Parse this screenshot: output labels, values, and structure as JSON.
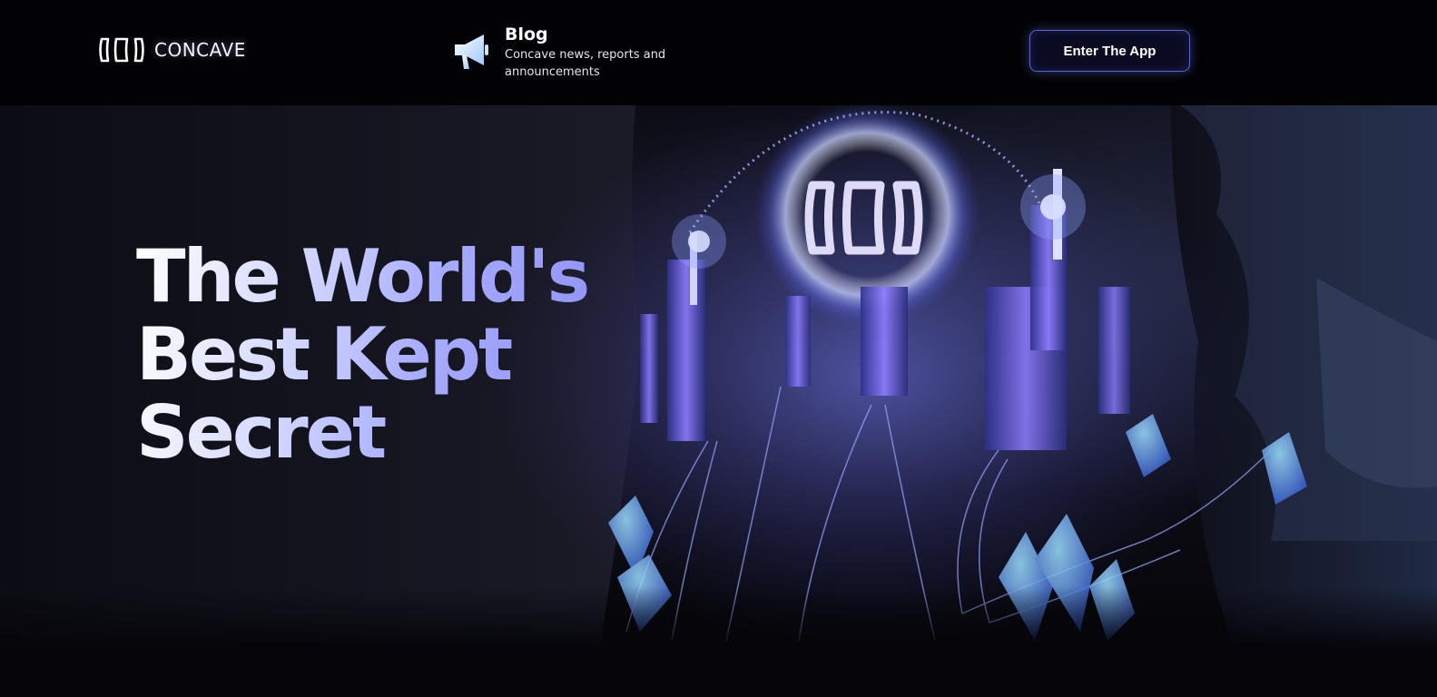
{
  "header": {
    "logo_text": "CONCAVE",
    "blog": {
      "title": "Blog",
      "description": "Concave news, reports and announcements"
    },
    "cta_label": "Enter The App"
  },
  "hero": {
    "headline_lines": [
      "The World's",
      "Best Kept",
      "Secret"
    ]
  },
  "colors": {
    "background": "#05050a",
    "accent": "#5e63c8",
    "headline_gradient_end": "#8d8ff0"
  },
  "icons": {
    "logo": "concave-logo-icon",
    "blog": "megaphone-icon"
  }
}
